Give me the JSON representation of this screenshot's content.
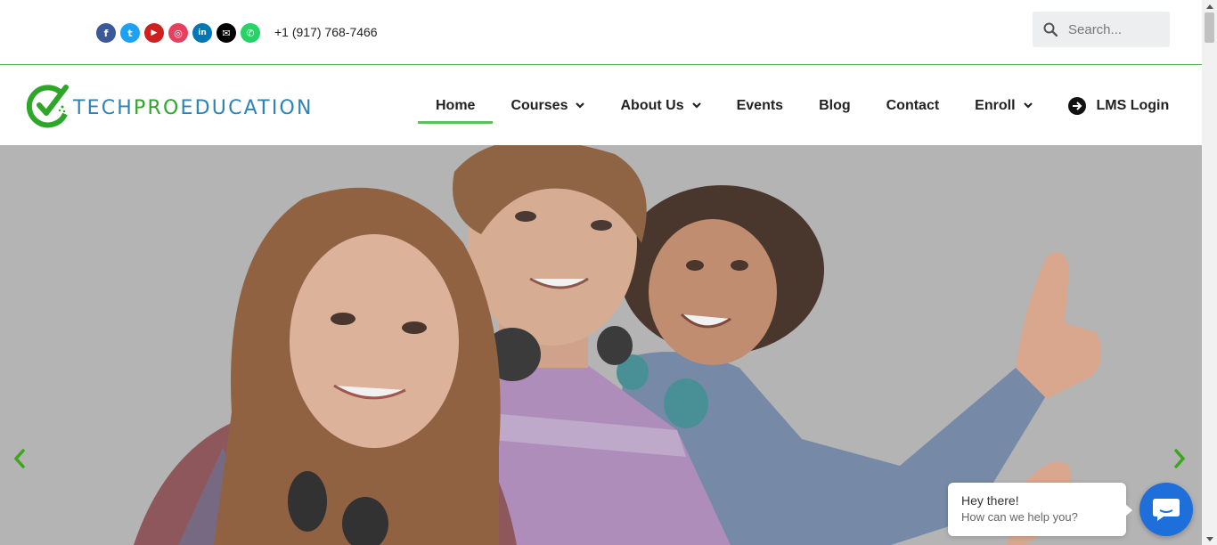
{
  "topbar": {
    "social": [
      {
        "name": "facebook",
        "icon": "facebook-icon",
        "glyph": "f",
        "color": "#3b5998"
      },
      {
        "name": "twitter",
        "icon": "twitter-icon",
        "glyph": "t",
        "color": "#1da1f2"
      },
      {
        "name": "youtube",
        "icon": "youtube-icon",
        "glyph": "▶",
        "color": "#cd201f"
      },
      {
        "name": "instagram",
        "icon": "instagram-icon",
        "glyph": "◎",
        "color": "#e4405f"
      },
      {
        "name": "linkedin",
        "icon": "linkedin-icon",
        "glyph": "in",
        "color": "#0077b5"
      },
      {
        "name": "email",
        "icon": "envelope-icon",
        "glyph": "✉",
        "color": "#000000"
      },
      {
        "name": "whatsapp",
        "icon": "whatsapp-icon",
        "glyph": "✆",
        "color": "#25d366"
      }
    ],
    "phone": "+1 (917) 768-7466",
    "search_placeholder": "Search..."
  },
  "logo": {
    "part1": "TECH",
    "part2": "PRO",
    "part3": "EDUCATION"
  },
  "nav": {
    "items": [
      {
        "label": "Home",
        "active": true,
        "dropdown": false
      },
      {
        "label": "Courses",
        "active": false,
        "dropdown": true
      },
      {
        "label": "About Us",
        "active": false,
        "dropdown": true
      },
      {
        "label": "Events",
        "active": false,
        "dropdown": false
      },
      {
        "label": "Blog",
        "active": false,
        "dropdown": false
      },
      {
        "label": "Contact",
        "active": false,
        "dropdown": false
      },
      {
        "label": "Enroll",
        "active": false,
        "dropdown": true
      }
    ],
    "login_label": "LMS Login"
  },
  "hero": {
    "accent": "#4caf50"
  },
  "chat": {
    "greeting": "Hey there!",
    "prompt": "How can we help you?"
  },
  "colors": {
    "accent_green": "#5cc05c",
    "chat_blue": "#1e6fd9"
  }
}
